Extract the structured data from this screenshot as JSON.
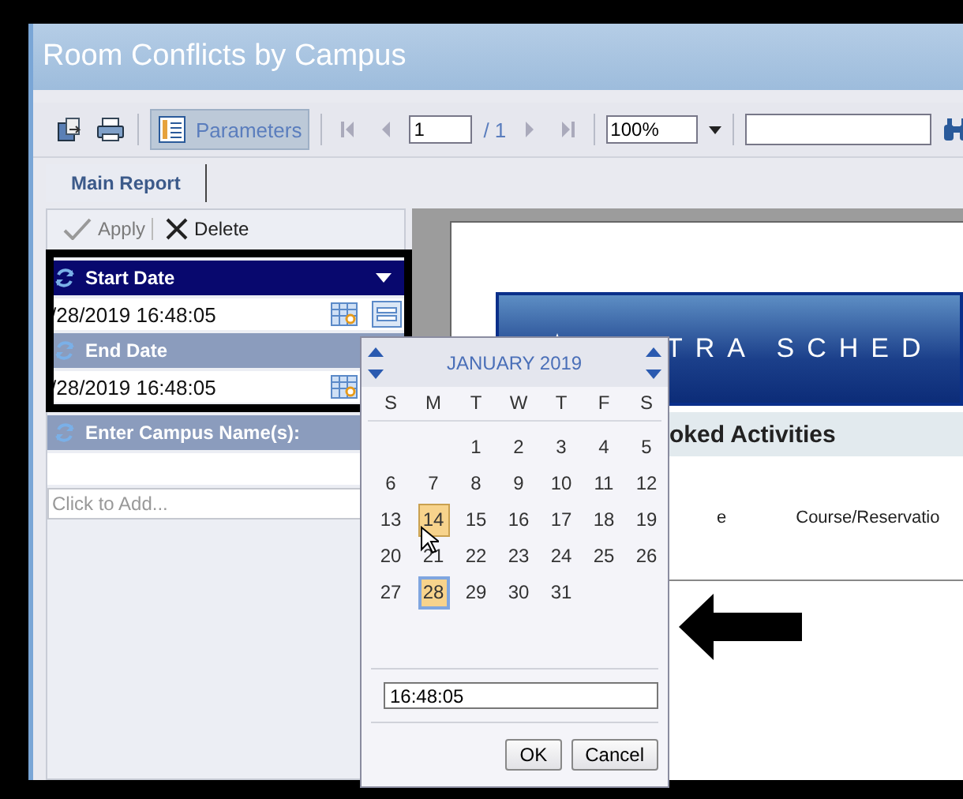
{
  "window": {
    "title": "Room Conflicts by Campus"
  },
  "toolbar": {
    "parameters_button": {
      "label": "Parameters",
      "selected": true
    },
    "page": "1",
    "page_total": "/ 1",
    "zoom": "100%"
  },
  "tabs": [
    {
      "label": "Main Report",
      "selected": true
    }
  ],
  "param_actions": [
    {
      "label": "Apply",
      "disabled": true
    },
    {
      "label": "Delete",
      "disabled": false
    }
  ],
  "parameters": [
    {
      "label": "Start Date",
      "selected": true,
      "value": "/28/2019 16:48:05"
    },
    {
      "label": "End Date",
      "selected": false,
      "value": "/28/2019 16:48:05"
    },
    {
      "label": "Enter Campus Name(s):",
      "selected": false,
      "placeholder": "Click to Add..."
    }
  ],
  "calendar": {
    "month": "JANUARY  2019",
    "weekdays": [
      "S",
      "M",
      "T",
      "W",
      "T",
      "F",
      "S"
    ],
    "weeks": [
      [
        {
          "d": "1",
          "hovered": false,
          "selected": false
        },
        {
          "d": "2",
          "hovered": false,
          "selected": false
        },
        {
          "d": "3",
          "hovered": false,
          "selected": false
        },
        {
          "d": "4",
          "hovered": false,
          "selected": false
        },
        {
          "d": "5",
          "hovered": false,
          "selected": false
        }
      ],
      [
        {
          "d": "6",
          "hovered": false,
          "selected": false
        },
        {
          "d": "7",
          "hovered": false,
          "selected": false
        },
        {
          "d": "8",
          "hovered": false,
          "selected": false
        },
        {
          "d": "9",
          "hovered": false,
          "selected": false
        },
        {
          "d": "10",
          "hovered": false,
          "selected": false
        },
        {
          "d": "11",
          "hovered": false,
          "selected": false
        },
        {
          "d": "12",
          "hovered": false,
          "selected": false
        }
      ],
      [
        {
          "d": "13",
          "hovered": false,
          "selected": false
        },
        {
          "d": "14",
          "hovered": true,
          "selected": false
        },
        {
          "d": "15",
          "hovered": false,
          "selected": false
        },
        {
          "d": "16",
          "hovered": false,
          "selected": false
        },
        {
          "d": "17",
          "hovered": false,
          "selected": false
        },
        {
          "d": "18",
          "hovered": false,
          "selected": false
        },
        {
          "d": "19",
          "hovered": false,
          "selected": false
        }
      ],
      [
        {
          "d": "20",
          "hovered": false,
          "selected": false
        },
        {
          "d": "21",
          "hovered": false,
          "selected": false
        },
        {
          "d": "22",
          "hovered": false,
          "selected": false
        },
        {
          "d": "23",
          "hovered": false,
          "selected": false
        },
        {
          "d": "24",
          "hovered": false,
          "selected": false
        },
        {
          "d": "25",
          "hovered": false,
          "selected": false
        },
        {
          "d": "26",
          "hovered": false,
          "selected": false
        }
      ],
      [
        {
          "d": "27",
          "hovered": false,
          "selected": false
        },
        {
          "d": "28",
          "hovered": false,
          "selected": true
        },
        {
          "d": "29",
          "hovered": false,
          "selected": false
        },
        {
          "d": "30",
          "hovered": false,
          "selected": false
        },
        {
          "d": "31",
          "hovered": false,
          "selected": false
        }
      ]
    ],
    "time": "16:48:05",
    "buttons": [
      "OK",
      "Cancel"
    ]
  },
  "report": {
    "banner": "TRA  SCHED",
    "section": "oked Activities",
    "columns": [
      "e",
      "Course/Reservatio"
    ]
  }
}
